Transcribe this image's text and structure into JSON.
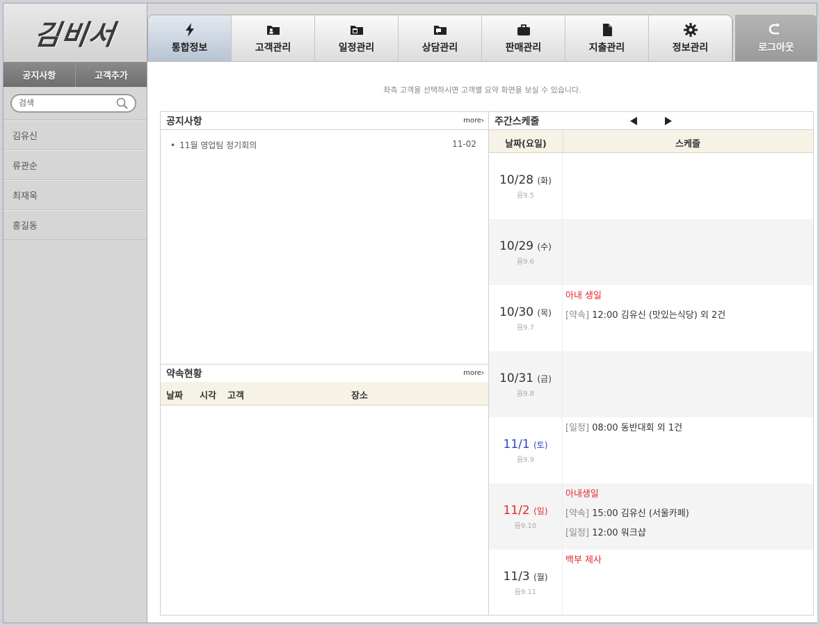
{
  "logo": {
    "text": "김비서"
  },
  "sidebar": {
    "tabs": [
      "공지사항",
      "고객추가"
    ],
    "search": {
      "placeholder": "검색"
    },
    "customers": [
      "김유신",
      "류관순",
      "최재욱",
      "홍길동"
    ]
  },
  "nav": {
    "tabs": [
      {
        "label": "통합정보",
        "icon": "lightning-icon"
      },
      {
        "label": "고객관리",
        "icon": "folder-person-icon"
      },
      {
        "label": "일정관리",
        "icon": "folder-calendar-icon"
      },
      {
        "label": "상담관리",
        "icon": "folder-chat-icon"
      },
      {
        "label": "판매관리",
        "icon": "briefcase-icon"
      },
      {
        "label": "지출관리",
        "icon": "document-icon"
      },
      {
        "label": "정보관리",
        "icon": "gear-icon"
      }
    ],
    "active_index": 0,
    "logout": {
      "label": "로그아웃",
      "icon": "logout-arrow-icon"
    }
  },
  "main": {
    "hint": "좌측 고객을 선택하시면 고객별 요약 화면을 보실 수 있습니다.",
    "notice": {
      "title": "공지사항",
      "more": "more›",
      "items": [
        {
          "text": "11월 영업팀 정기회의",
          "date": "11-02"
        }
      ]
    },
    "appointments": {
      "title": "약속현황",
      "more": "more›",
      "columns": [
        "날짜",
        "시각",
        "고객",
        "장소"
      ]
    },
    "weekly": {
      "title": "주간스케줄",
      "columns": [
        "날짜(요일)",
        "스케줄"
      ],
      "days": [
        {
          "date": "10/28",
          "dow": "(화)",
          "lunar": "음9.5",
          "kind": "normal",
          "events": []
        },
        {
          "date": "10/29",
          "dow": "(수)",
          "lunar": "음9.6",
          "kind": "normal",
          "events": []
        },
        {
          "date": "10/30",
          "dow": "(목)",
          "lunar": "음9.7",
          "kind": "normal",
          "events": [
            {
              "tag": "",
              "text": "아내 생일",
              "red": true
            },
            {
              "tag": "[약속]",
              "text": " 12:00 김유신 (맛있는식당) 외 2건",
              "red": false
            }
          ]
        },
        {
          "date": "10/31",
          "dow": "(금)",
          "lunar": "음9.8",
          "kind": "normal",
          "events": []
        },
        {
          "date": "11/1",
          "dow": "(토)",
          "lunar": "음9.9",
          "kind": "sat",
          "events": [
            {
              "tag": "[일정]",
              "text": " 08:00 동반대회 외 1건",
              "red": false
            }
          ]
        },
        {
          "date": "11/2",
          "dow": "(일)",
          "lunar": "음9.10",
          "kind": "sun",
          "events": [
            {
              "tag": "",
              "text": "아내생일",
              "red": true
            },
            {
              "tag": "[약속]",
              "text": " 15:00 김유신 (서울카페)",
              "red": false
            },
            {
              "tag": "[일정]",
              "text": " 12:00 워크샵",
              "red": false
            }
          ]
        },
        {
          "date": "11/3",
          "dow": "(월)",
          "lunar": "음9.11",
          "kind": "normal",
          "events": [
            {
              "tag": "",
              "text": "백부 제사",
              "red": true
            }
          ]
        }
      ]
    }
  },
  "colors": {
    "saturday": "#2f43c9",
    "sunday": "#e02b2b",
    "event_red": "#e8262b",
    "header_bg": "#f6f3e6"
  }
}
